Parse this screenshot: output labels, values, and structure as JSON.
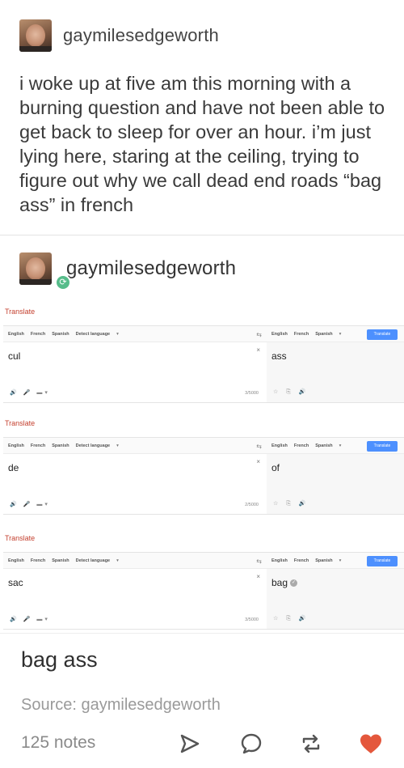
{
  "post1": {
    "username": "gaymilesedgeworth",
    "text": "i woke up at five am this morning with a burning question and have not been able to get back to sleep for over an hour. i’m just lying here, staring at the ceiling, trying to figure out why we call dead end roads “bag ass” in french"
  },
  "post2": {
    "username": "gaymilesedgeworth",
    "translations": [
      {
        "title": "Translate",
        "source_langs": [
          "English",
          "French",
          "Spanish",
          "Detect language",
          "▾"
        ],
        "target_langs": [
          "English",
          "French",
          "Spanish",
          "▾"
        ],
        "button": "Translate",
        "input": "cul",
        "output": "ass",
        "char_count": "3/5000",
        "clear": "×"
      },
      {
        "title": "Translate",
        "source_langs": [
          "English",
          "French",
          "Spanish",
          "Detect language",
          "▾"
        ],
        "target_langs": [
          "English",
          "French",
          "Spanish",
          "▾"
        ],
        "button": "Translate",
        "input": "de",
        "output": "of",
        "char_count": "2/5000",
        "clear": "×"
      },
      {
        "title": "Translate",
        "source_langs": [
          "English",
          "French",
          "Spanish",
          "Detect language",
          "▾"
        ],
        "target_langs": [
          "English",
          "French",
          "Spanish",
          "▾"
        ],
        "button": "Translate",
        "input": "sac",
        "output": "bag",
        "char_count": "3/5000",
        "clear": "×"
      }
    ],
    "answer": "bag ass",
    "source_label": "Source:",
    "source_name": "gaymilesedgeworth"
  },
  "footer": {
    "notes": "125 notes",
    "icons": [
      "share-icon",
      "reply-icon",
      "reblog-icon",
      "like-icon"
    ],
    "like_color": "#e4573c"
  },
  "colors": {
    "translate_title": "#c4402f",
    "translate_button": "#4d90fe",
    "reblog_badge": "#56bc8a"
  }
}
